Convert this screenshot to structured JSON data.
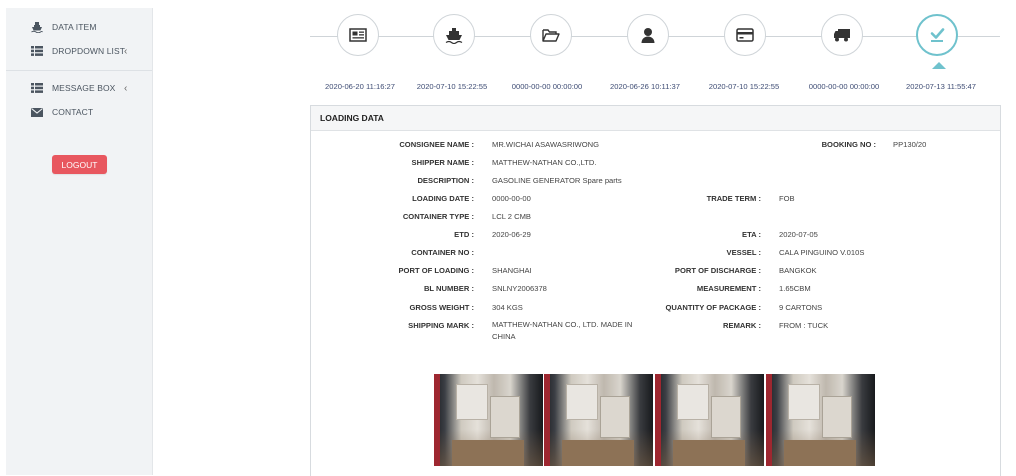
{
  "sidebar": {
    "items": [
      {
        "label": "DATA ITEM",
        "icon": "ship-icon"
      },
      {
        "label": "DROPDOWN LIST",
        "icon": "list-icon",
        "chevron": "‹"
      },
      {
        "label": "MESSAGE BOX",
        "icon": "list-icon",
        "chevron": "‹"
      },
      {
        "label": "CONTACT",
        "icon": "envelope-icon"
      }
    ],
    "logout_label": "LOGOUT"
  },
  "timeline": {
    "steps": [
      {
        "icon": "document-icon",
        "date": "2020-06-20 11:16:27"
      },
      {
        "icon": "ship-icon",
        "date": "2020-07-10 15:22:55"
      },
      {
        "icon": "folder-open-icon",
        "date": "0000-00-00 00:00:00"
      },
      {
        "icon": "user-icon",
        "date": "2020-06-26 10:11:37"
      },
      {
        "icon": "credit-card-icon",
        "date": "2020-07-10 15:22:55"
      },
      {
        "icon": "truck-icon",
        "date": "0000-00-00 00:00:00"
      },
      {
        "icon": "check-icon",
        "date": "2020-07-13 11:55:47",
        "active": true
      }
    ]
  },
  "panel": {
    "title": "LOADING DATA",
    "fields": {
      "consignee_name": {
        "label": "CONSIGNEE NAME :",
        "value": "MR.WICHAI ASAWASRIWONG"
      },
      "booking_no": {
        "label": "BOOKING NO :",
        "value": "PP130/20"
      },
      "shipper_name": {
        "label": "SHIPPER NAME :",
        "value": "MATTHEW-NATHAN CO.,LTD."
      },
      "description": {
        "label": "DESCRIPTION :",
        "value": "GASOLINE GENERATOR Spare parts"
      },
      "loading_date": {
        "label": "LOADING DATE :",
        "value": "0000-00-00"
      },
      "trade_term": {
        "label": "TRADE TERM :",
        "value": "FOB"
      },
      "container_type": {
        "label": "CONTAINER TYPE :",
        "value": "LCL 2 CMB"
      },
      "etd": {
        "label": "ETD :",
        "value": "2020-06-29"
      },
      "eta": {
        "label": "ETA :",
        "value": "2020-07-05"
      },
      "container_no": {
        "label": "CONTAINER NO :",
        "value": ""
      },
      "vessel": {
        "label": "VESSEL :",
        "value": "CALA PINGUINO V.010S"
      },
      "port_of_loading": {
        "label": "PORT OF LOADING :",
        "value": "SHANGHAI"
      },
      "port_of_discharge": {
        "label": "PORT OF DISCHARGE :",
        "value": "BANGKOK"
      },
      "bl_number": {
        "label": "BL NUMBER :",
        "value": "SNLNY2006378"
      },
      "measurement": {
        "label": "MEASUREMENT :",
        "value": "1.65CBM"
      },
      "gross_weight": {
        "label": "GROSS WEIGHT :",
        "value": "304 KGS"
      },
      "quantity_of_package": {
        "label": "QUANTITY OF PACKAGE :",
        "value": "9 CARTONS"
      },
      "shipping_mark": {
        "label": "SHIPPING MARK :",
        "value": "MATTHEW-NATHAN CO., LTD. MADE IN CHINA"
      },
      "remark": {
        "label": "REMARK :",
        "value": "FROM : TUCK"
      }
    }
  },
  "colors": {
    "accent": "#6fc2cd",
    "logout": "#e8575f",
    "date_text": "#3e4c74"
  }
}
